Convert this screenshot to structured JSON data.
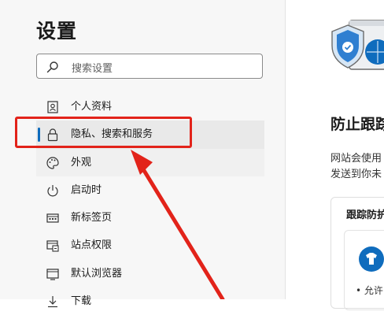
{
  "settings": {
    "title": "设置",
    "search_placeholder": "搜索设置"
  },
  "sidebar": {
    "items": [
      {
        "label": "个人资料",
        "icon": "profile-icon"
      },
      {
        "label": "隐私、搜索和服务",
        "icon": "lock-icon",
        "active": true
      },
      {
        "label": "外观",
        "icon": "palette-icon"
      },
      {
        "label": "启动时",
        "icon": "power-icon"
      },
      {
        "label": "新标签页",
        "icon": "new-tab-icon"
      },
      {
        "label": "站点权限",
        "icon": "site-permissions-icon"
      },
      {
        "label": "默认浏览器",
        "icon": "default-browser-icon"
      },
      {
        "label": "下载",
        "icon": "download-icon"
      }
    ]
  },
  "main": {
    "heading": "防止跟踪",
    "desc_line1": "网站会使用",
    "desc_line2": "发送到你未",
    "card_title": "跟踪防护",
    "bullet": "• 允许"
  },
  "colors": {
    "accent": "#0f6cbd",
    "annotation": "#e2231a"
  }
}
